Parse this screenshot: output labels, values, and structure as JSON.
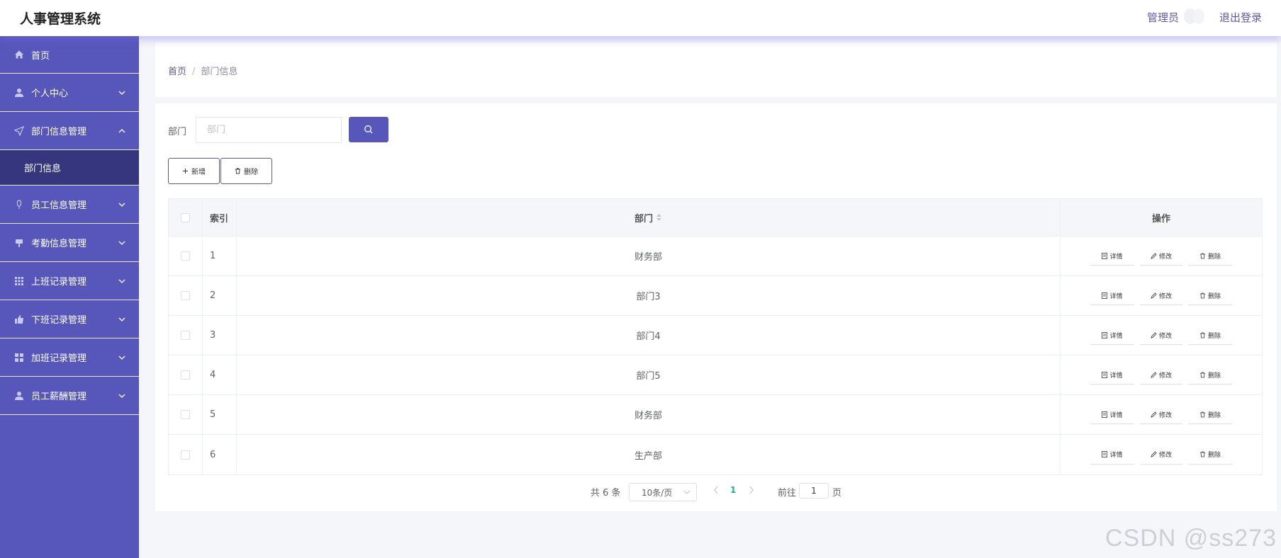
{
  "header": {
    "title": "人事管理系统",
    "user_role": "管理员",
    "logout": "退出登录"
  },
  "sidebar": {
    "items": [
      {
        "label": "首页",
        "icon": "home-icon"
      },
      {
        "label": "个人中心",
        "icon": "user-icon"
      },
      {
        "label": "部门信息管理",
        "icon": "send-icon",
        "expanded": true
      },
      {
        "label": "员工信息管理",
        "icon": "microphone-icon"
      },
      {
        "label": "考勤信息管理",
        "icon": "flag-icon"
      },
      {
        "label": "上班记录管理",
        "icon": "grid-icon"
      },
      {
        "label": "下班记录管理",
        "icon": "thumb-up-icon"
      },
      {
        "label": "加班记录管理",
        "icon": "apps-icon"
      },
      {
        "label": "员工薪酬管理",
        "icon": "user-icon"
      }
    ],
    "submenu": {
      "label": "部门信息"
    }
  },
  "breadcrumb": {
    "home": "首页",
    "separator": "/",
    "current": "部门信息"
  },
  "search": {
    "label": "部门",
    "placeholder": "部门"
  },
  "actions": {
    "add": "新增",
    "delete": "删除"
  },
  "table": {
    "headers": {
      "index": "索引",
      "dept": "部门",
      "ops": "操作"
    },
    "ops": {
      "detail": "详情",
      "edit": "修改",
      "delete": "删除"
    },
    "rows": [
      {
        "index": "1",
        "dept": "财务部"
      },
      {
        "index": "2",
        "dept": "部门3"
      },
      {
        "index": "3",
        "dept": "部门4"
      },
      {
        "index": "4",
        "dept": "部门5"
      },
      {
        "index": "5",
        "dept": "财务部"
      },
      {
        "index": "6",
        "dept": "生产部"
      }
    ]
  },
  "pagination": {
    "total": "共 6 条",
    "page_size": "10条/页",
    "current_page": "1",
    "goto_label": "前往",
    "goto_value": "1",
    "page_suffix": "页"
  },
  "watermark": "CSDN @ss273",
  "colors": {
    "sidebar_bg": "#5656bb",
    "sidebar_active_sub": "#36367f",
    "accent": "#5656bb",
    "page_active": "#1ab394"
  }
}
